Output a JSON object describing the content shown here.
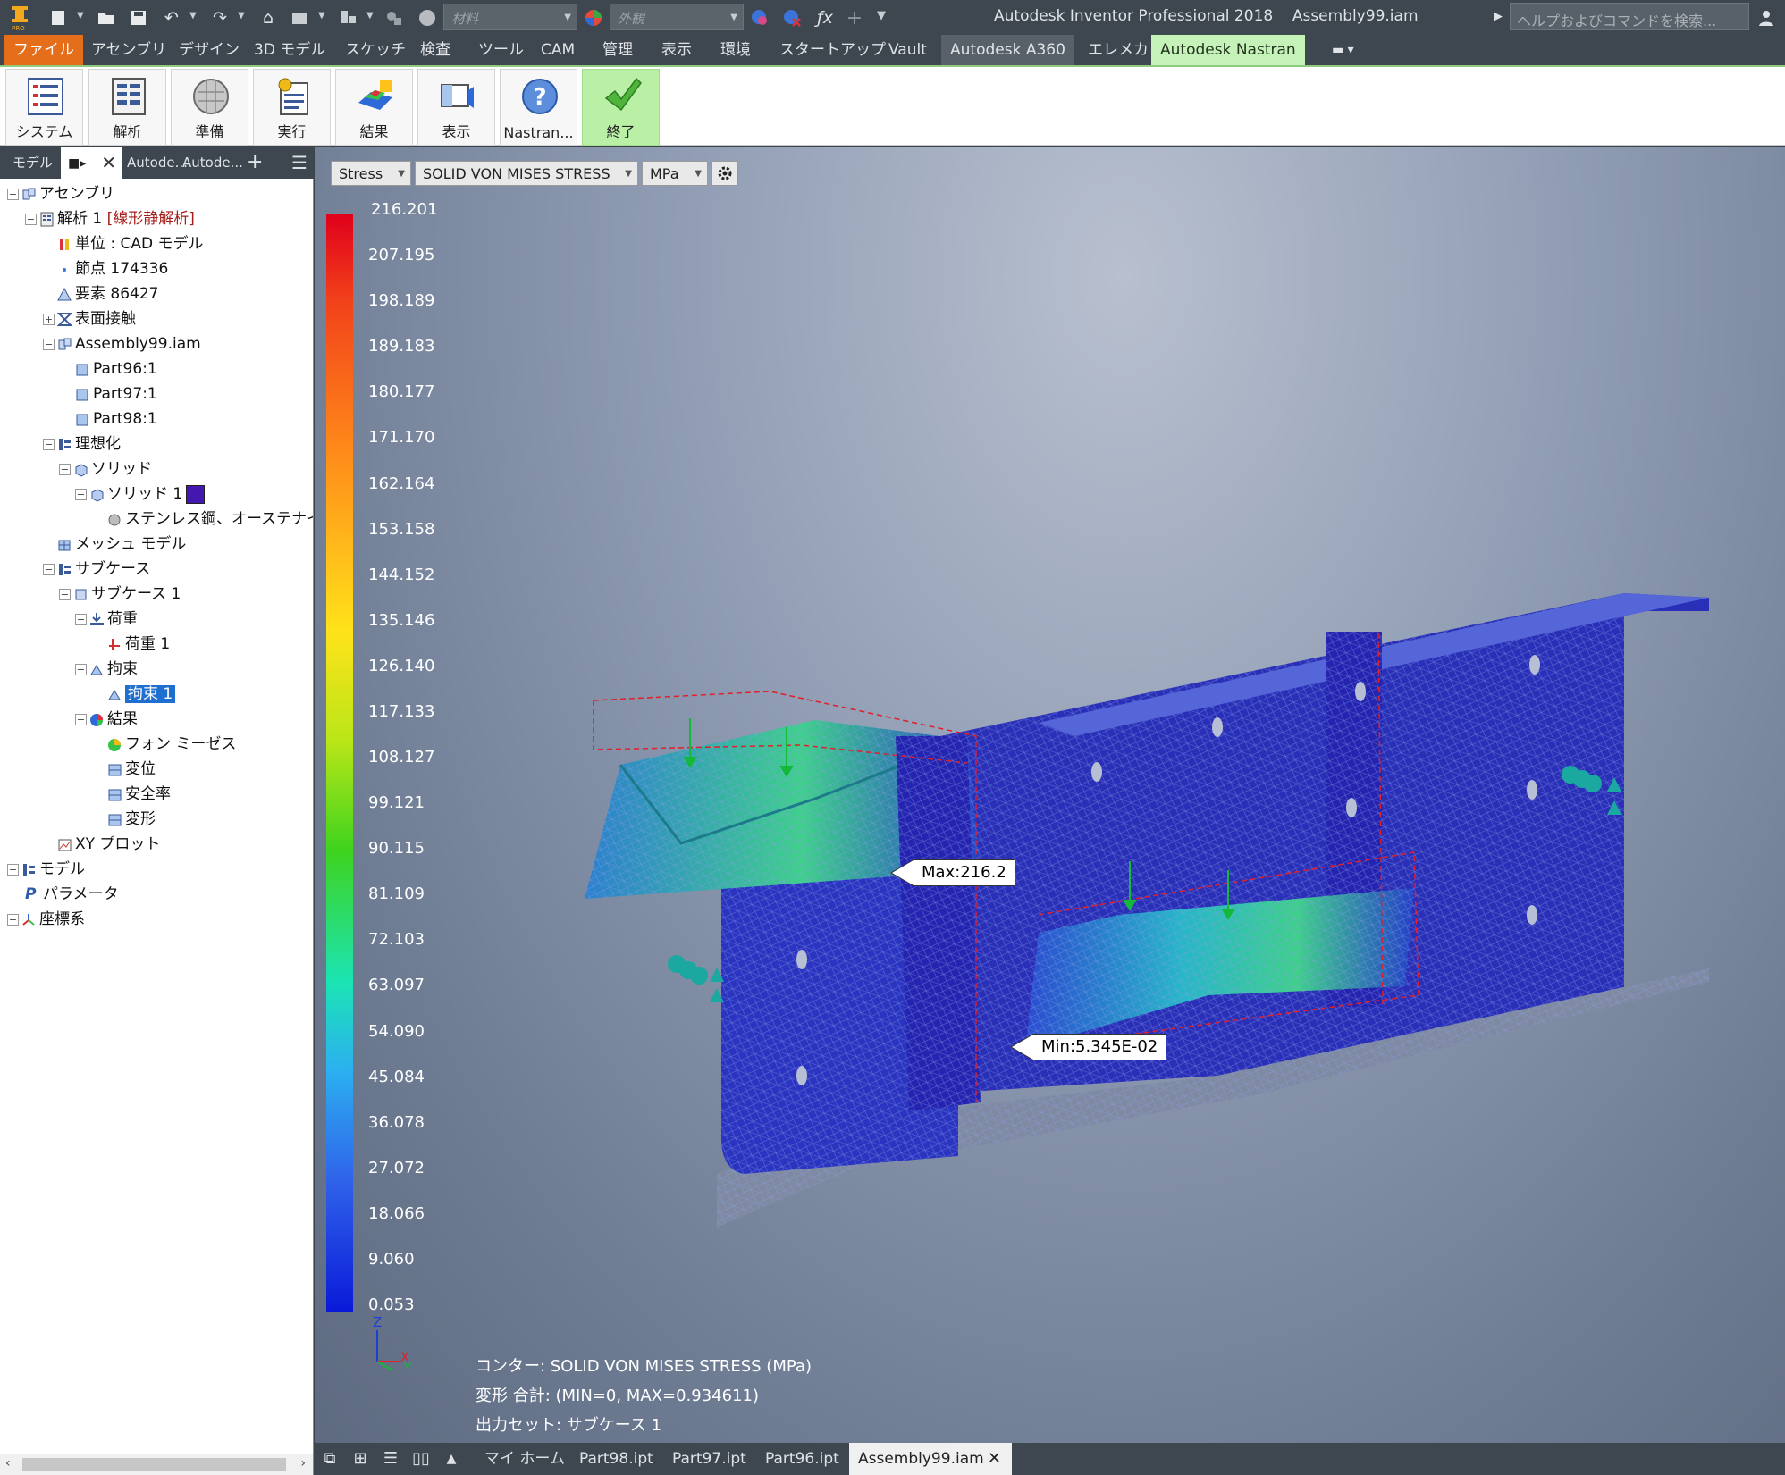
{
  "titlebar": {
    "material_placeholder": "材料",
    "appearance_placeholder": "外観",
    "app_name": "Autodesk Inventor Professional 2018",
    "document": "Assembly99.iam",
    "help_search": "ヘルプおよびコマンドを検索..."
  },
  "menu": [
    "ファイル",
    "アセンブリ",
    "デザイン",
    "3D モデル",
    "スケッチ",
    "検査",
    "ツール",
    "CAM",
    "管理",
    "表示",
    "環境",
    "スタートアップ",
    "Vault",
    "Autodesk A360",
    "エレメカ",
    "Autodesk Nastran"
  ],
  "ribbon": [
    "システム",
    "解析",
    "準備",
    "実行",
    "結果",
    "表示",
    "Nastran...",
    "終了"
  ],
  "browser": {
    "tabs": [
      "モデル",
      "Autode...",
      "Autode..."
    ],
    "tree": [
      {
        "label": "アセンブリ"
      },
      {
        "label": "解析 1",
        "tag": "[線形静解析]"
      },
      {
        "label": "単位 : CAD モデル"
      },
      {
        "label": "節点 174336"
      },
      {
        "label": "要素 86427"
      },
      {
        "label": "表面接触"
      },
      {
        "label": "Assembly99.iam"
      },
      {
        "label": "Part96:1"
      },
      {
        "label": "Part97:1"
      },
      {
        "label": "Part98:1"
      },
      {
        "label": "理想化"
      },
      {
        "label": "ソリッド"
      },
      {
        "label": "ソリッド 1"
      },
      {
        "label": "ステンレス鋼、オーステナイト系"
      },
      {
        "label": "メッシュ モデル"
      },
      {
        "label": "サブケース"
      },
      {
        "label": "サブケース 1"
      },
      {
        "label": "荷重"
      },
      {
        "label": "荷重 1"
      },
      {
        "label": "拘束"
      },
      {
        "label": "拘束 1"
      },
      {
        "label": "結果"
      },
      {
        "label": "フォン ミーゼス"
      },
      {
        "label": "変位"
      },
      {
        "label": "安全率"
      },
      {
        "label": "変形"
      },
      {
        "label": "XY プロット"
      },
      {
        "label": "モデル"
      },
      {
        "label": "パラメータ"
      },
      {
        "label": "座標系"
      }
    ]
  },
  "viewport": {
    "result_type": "Stress",
    "result_component": "SOLID VON MISES STRESS",
    "unit": "MPa",
    "legend_values": [
      "216.201",
      "207.195",
      "198.189",
      "189.183",
      "180.177",
      "171.170",
      "162.164",
      "153.158",
      "144.152",
      "135.146",
      "126.140",
      "117.133",
      "108.127",
      "99.121",
      "90.115",
      "81.109",
      "72.103",
      "63.097",
      "54.090",
      "45.084",
      "36.078",
      "27.072",
      "18.066",
      "9.060",
      "0.053"
    ],
    "max_label": "Max:216.2",
    "min_label": "Min:5.345E-02",
    "axis_z": "Z",
    "axis_x": "X",
    "axis_y": "Y",
    "info_contour": "コンター: SOLID VON MISES STRESS (MPa)",
    "info_deform": "変形 合計: (MIN=0, MAX=0.934611)",
    "info_output": "出力セット: サブケース 1"
  },
  "doctabs": [
    "マイ ホーム",
    "Part98.ipt",
    "Part97.ipt",
    "Part96.ipt",
    "Assembly99.iam"
  ],
  "colors": {
    "accent": "#e46e19",
    "nastran_tab": "#c4f2b9",
    "selection": "#1f6fd1",
    "mesh_blue": "#2a2fb8"
  }
}
